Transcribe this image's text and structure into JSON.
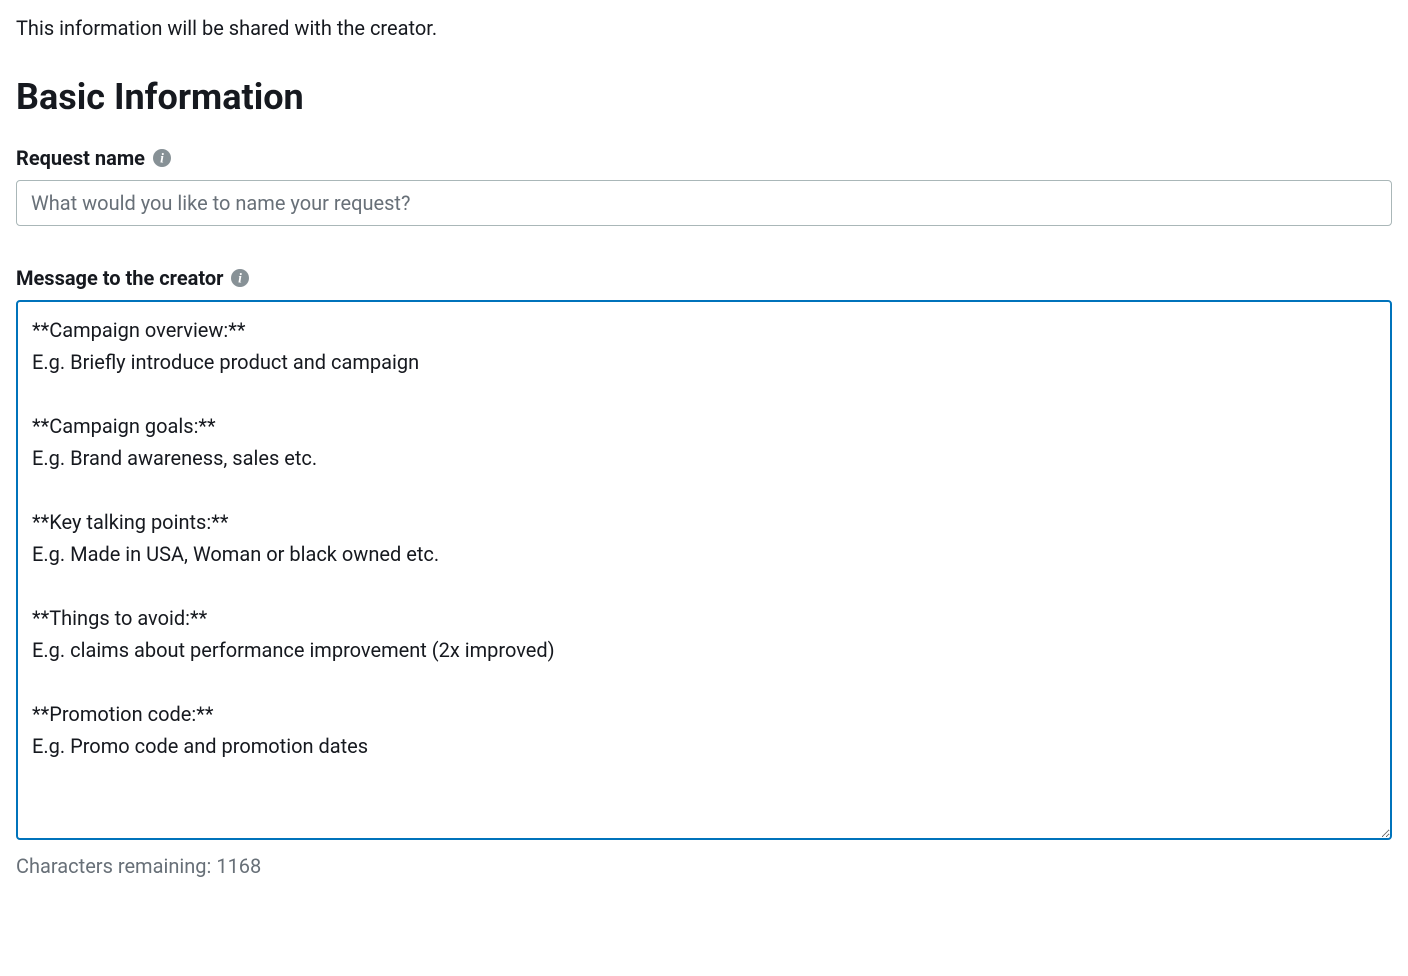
{
  "intro": "This information will be shared with the creator.",
  "section_heading": "Basic Information",
  "request_name": {
    "label": "Request name",
    "placeholder": "What would you like to name your request?",
    "value": ""
  },
  "message": {
    "label": "Message to the creator",
    "value": "**Campaign overview:**\nE.g. Briefly introduce product and campaign\n\n**Campaign goals:**\nE.g. Brand awareness, sales etc.\n\n**Key talking points:**\nE.g. Made in USA, Woman or black owned etc.\n\n**Things to avoid:**\nE.g. claims about performance improvement (2x improved)\n\n**Promotion code:**\nE.g. Promo code and promotion dates",
    "char_count_prefix": "Characters remaining: ",
    "char_count_value": "1168"
  }
}
